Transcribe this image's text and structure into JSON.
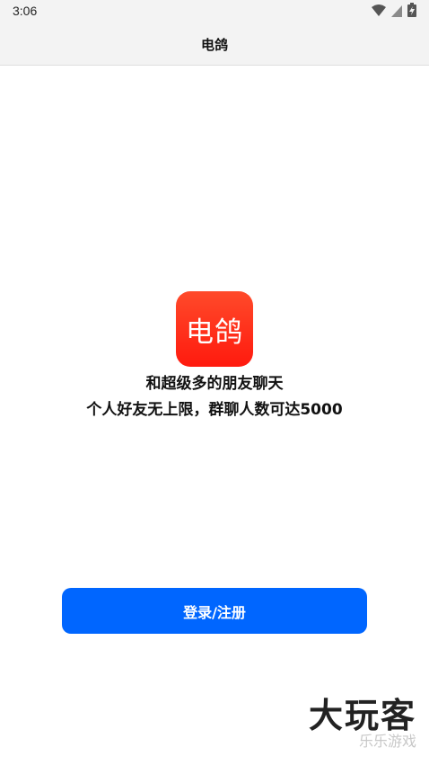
{
  "status_bar": {
    "time": "3:06",
    "icons": [
      "wifi-icon",
      "signal-icon",
      "battery-charging-icon"
    ]
  },
  "header": {
    "title": "电鸽"
  },
  "app_icon": {
    "label": "电鸽",
    "colors": [
      "#ff4a2a",
      "#ff1a0e"
    ]
  },
  "tagline": {
    "line1": "和超级多的朋友聊天",
    "line2": "个人好友无上限，群聊人数可达5000"
  },
  "login_button": {
    "label": "登录/注册",
    "color": "#0066ff"
  },
  "watermark": {
    "main": "大玩客",
    "sub": "乐乐游戏"
  }
}
